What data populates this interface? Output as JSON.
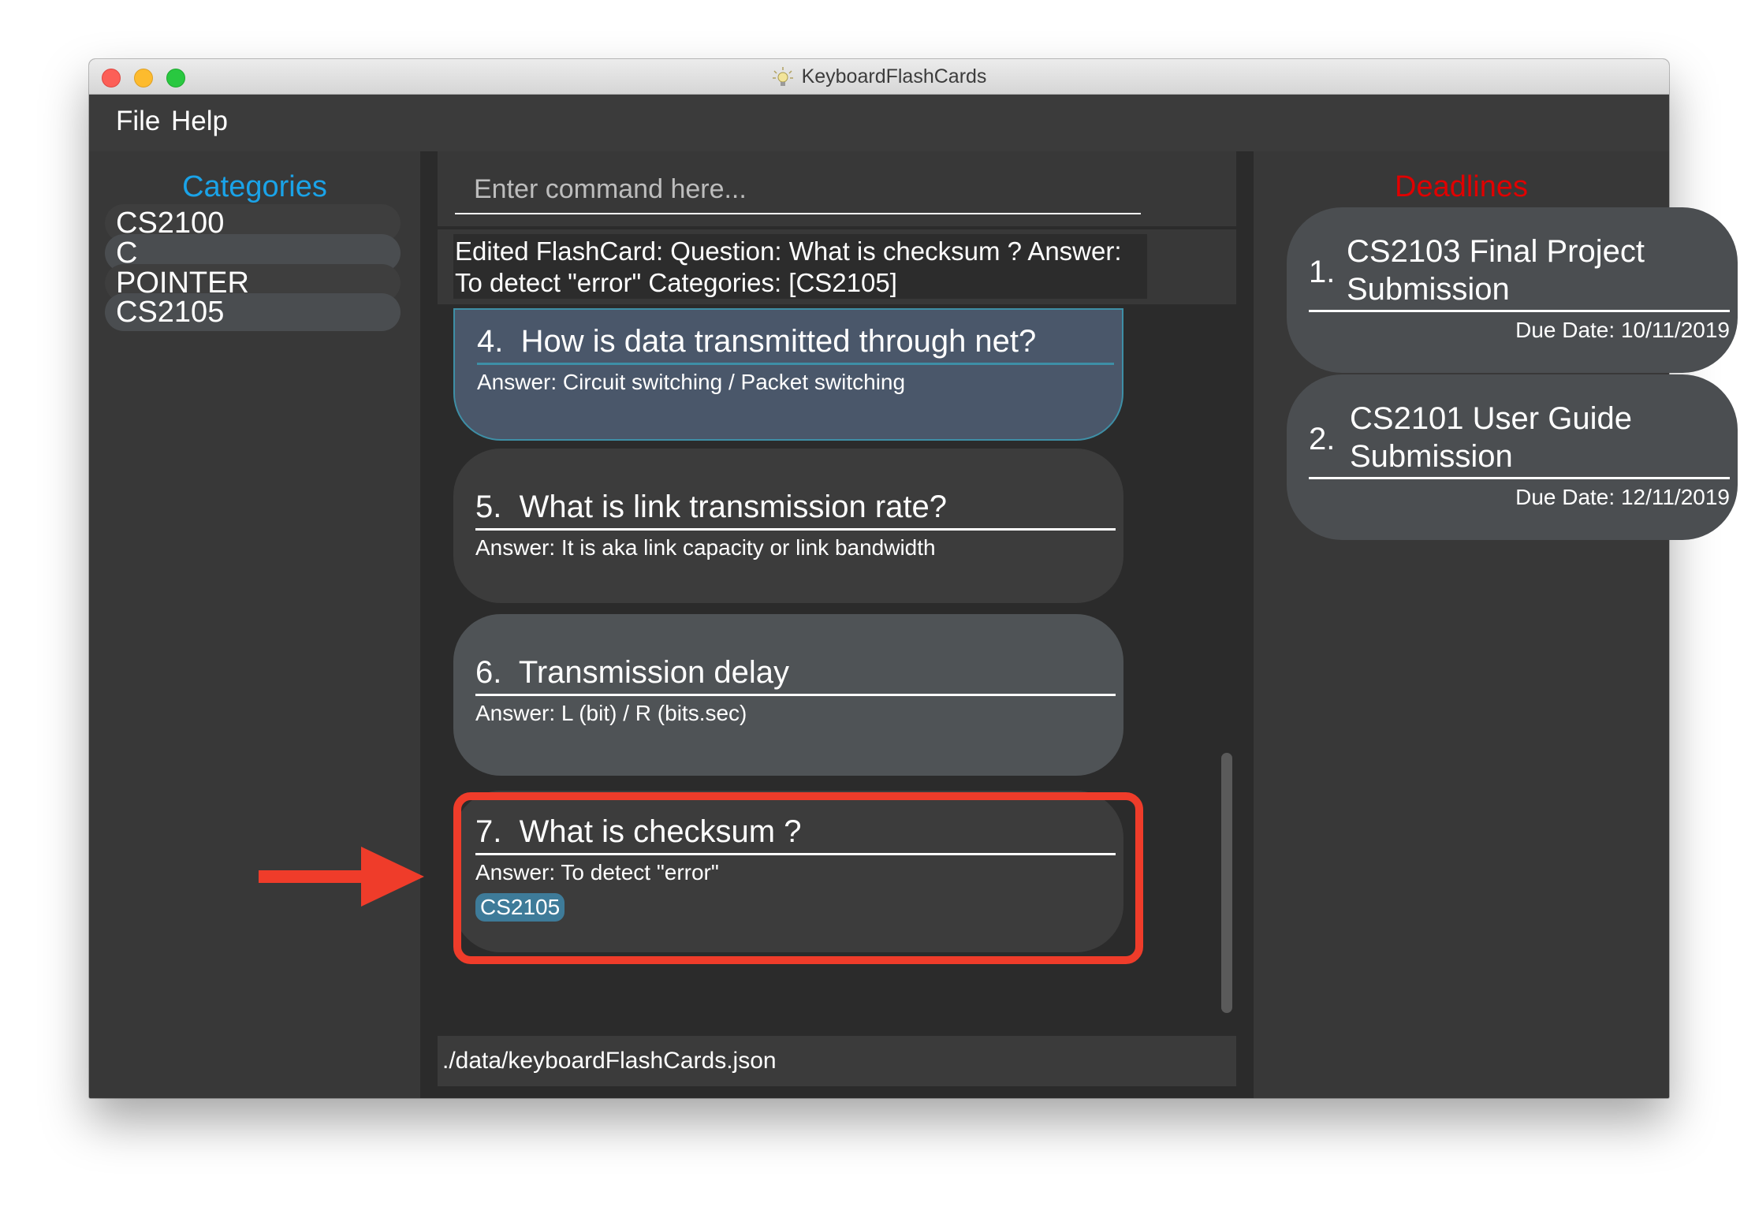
{
  "window": {
    "title": "KeyboardFlashCards"
  },
  "menu": {
    "file": "File",
    "help": "Help"
  },
  "categories": {
    "title": "Categories",
    "items": [
      "CS2100",
      "C",
      "POINTER",
      "CS2105"
    ]
  },
  "command": {
    "placeholder": "Enter command here..."
  },
  "result": {
    "text": "Edited FlashCard: Question: What is checksum ? Answer: To detect \"error\" Categories: [CS2105]"
  },
  "cards": [
    {
      "number": "4.",
      "question": "How is data transmitted through net?",
      "answer": "Answer: Circuit switching / Packet switching"
    },
    {
      "number": "5.",
      "question": "What is link transmission rate?",
      "answer": "Answer: It is aka link capacity or link bandwidth"
    },
    {
      "number": "6.",
      "question": "Transmission delay",
      "answer": "Answer: L (bit) / R (bits.sec)"
    },
    {
      "number": "7.",
      "question": "What is checksum ?",
      "answer": "Answer: To detect \"error\"",
      "tag": "CS2105"
    }
  ],
  "status": {
    "path": "./data/keyboardFlashCards.json"
  },
  "deadlines": {
    "title": "Deadlines",
    "items": [
      {
        "number": "1.",
        "title": "CS2103 Final Project Submission",
        "due": "Due Date: 10/11/2019"
      },
      {
        "number": "2.",
        "title": "CS2101 User Guide Submission",
        "due": "Due Date: 12/11/2019"
      }
    ]
  },
  "colors": {
    "categories_title": "#1aa3e8",
    "deadlines_title": "#e00000",
    "highlight": "#ef3c2a",
    "tag": "#3e7b99"
  }
}
